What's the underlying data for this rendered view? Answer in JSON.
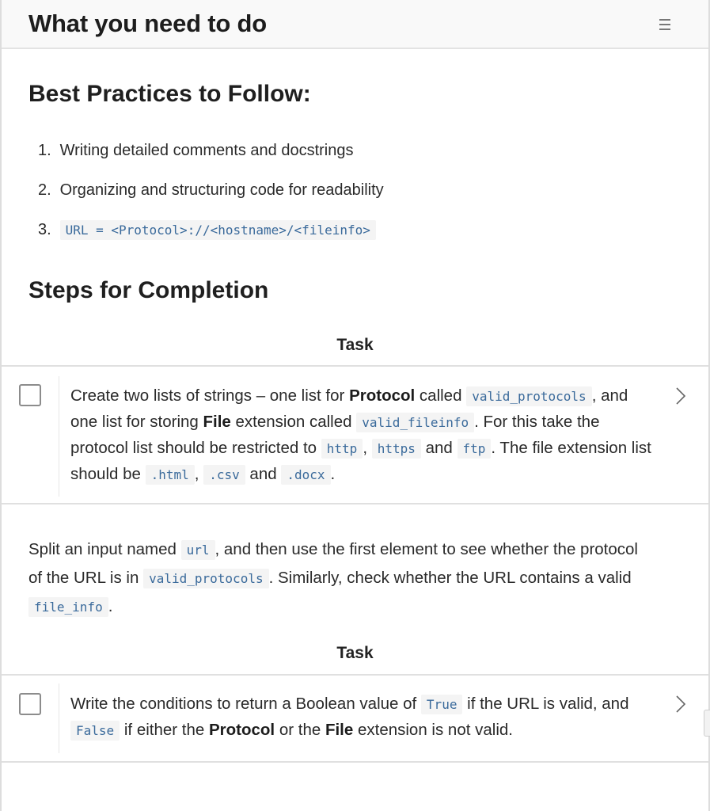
{
  "header": {
    "title": "What you need to do",
    "menu_icon": "hamburger-menu-icon"
  },
  "best_practices": {
    "title": "Best Practices to Follow:",
    "items": [
      {
        "num": "1.",
        "text": "Writing detailed comments and docstrings"
      },
      {
        "num": "2.",
        "text": "Organizing and structuring code for readability"
      },
      {
        "num": "3.",
        "code": "URL = <Protocol>://<hostname>/<fileinfo>"
      }
    ]
  },
  "steps": {
    "title": "Steps for Completion",
    "task_label": "Task",
    "task1": {
      "checked": false,
      "parts": {
        "t1": "Create two lists of strings – one list for ",
        "b1": "Protocol",
        "t2": " called ",
        "c1": "valid_protocols",
        "t3": ", and one list for storing ",
        "b2": "File",
        "t4": " extension called ",
        "c2": "valid_fileinfo",
        "t5": ". For this take the protocol list should be restricted to ",
        "c3": "http",
        "t6": ", ",
        "c4": "https",
        "t7": " and ",
        "c5": "ftp",
        "t8": ". The file extension list should be ",
        "c6": ".html",
        "t9": ", ",
        "c7": ".csv",
        "t10": " and ",
        "c8": ".docx",
        "t11": "."
      }
    },
    "paragraph": {
      "t1": "Split an input named ",
      "c1": "url",
      "t2": ", and then use the first element to see whether the protocol of the URL is in ",
      "c2": "valid_protocols",
      "t3": ". Similarly, check whether the URL contains a valid ",
      "c3": "file_info",
      "t4": "."
    },
    "task2": {
      "checked": false,
      "parts": {
        "t1": "Write the conditions to return a Boolean value of ",
        "c1": "True",
        "t2": " if the URL is valid, and ",
        "c2": "False",
        "t3": " if either the ",
        "b1": "Protocol",
        "t4": " or the ",
        "b2": "File",
        "t5": " extension is not valid."
      }
    }
  }
}
